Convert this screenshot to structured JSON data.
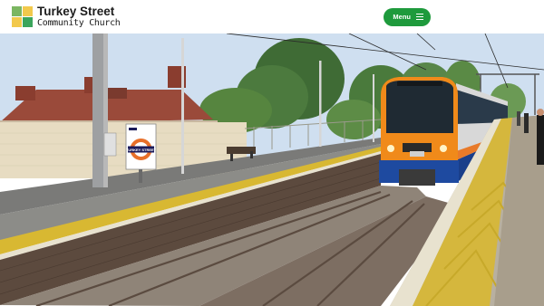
{
  "site": {
    "name_line1": "Turkey Street",
    "name_line2": "Community Church"
  },
  "header": {
    "menu_label": "Menu"
  },
  "hero": {
    "roundel_text": "TURKEY STREET"
  }
}
